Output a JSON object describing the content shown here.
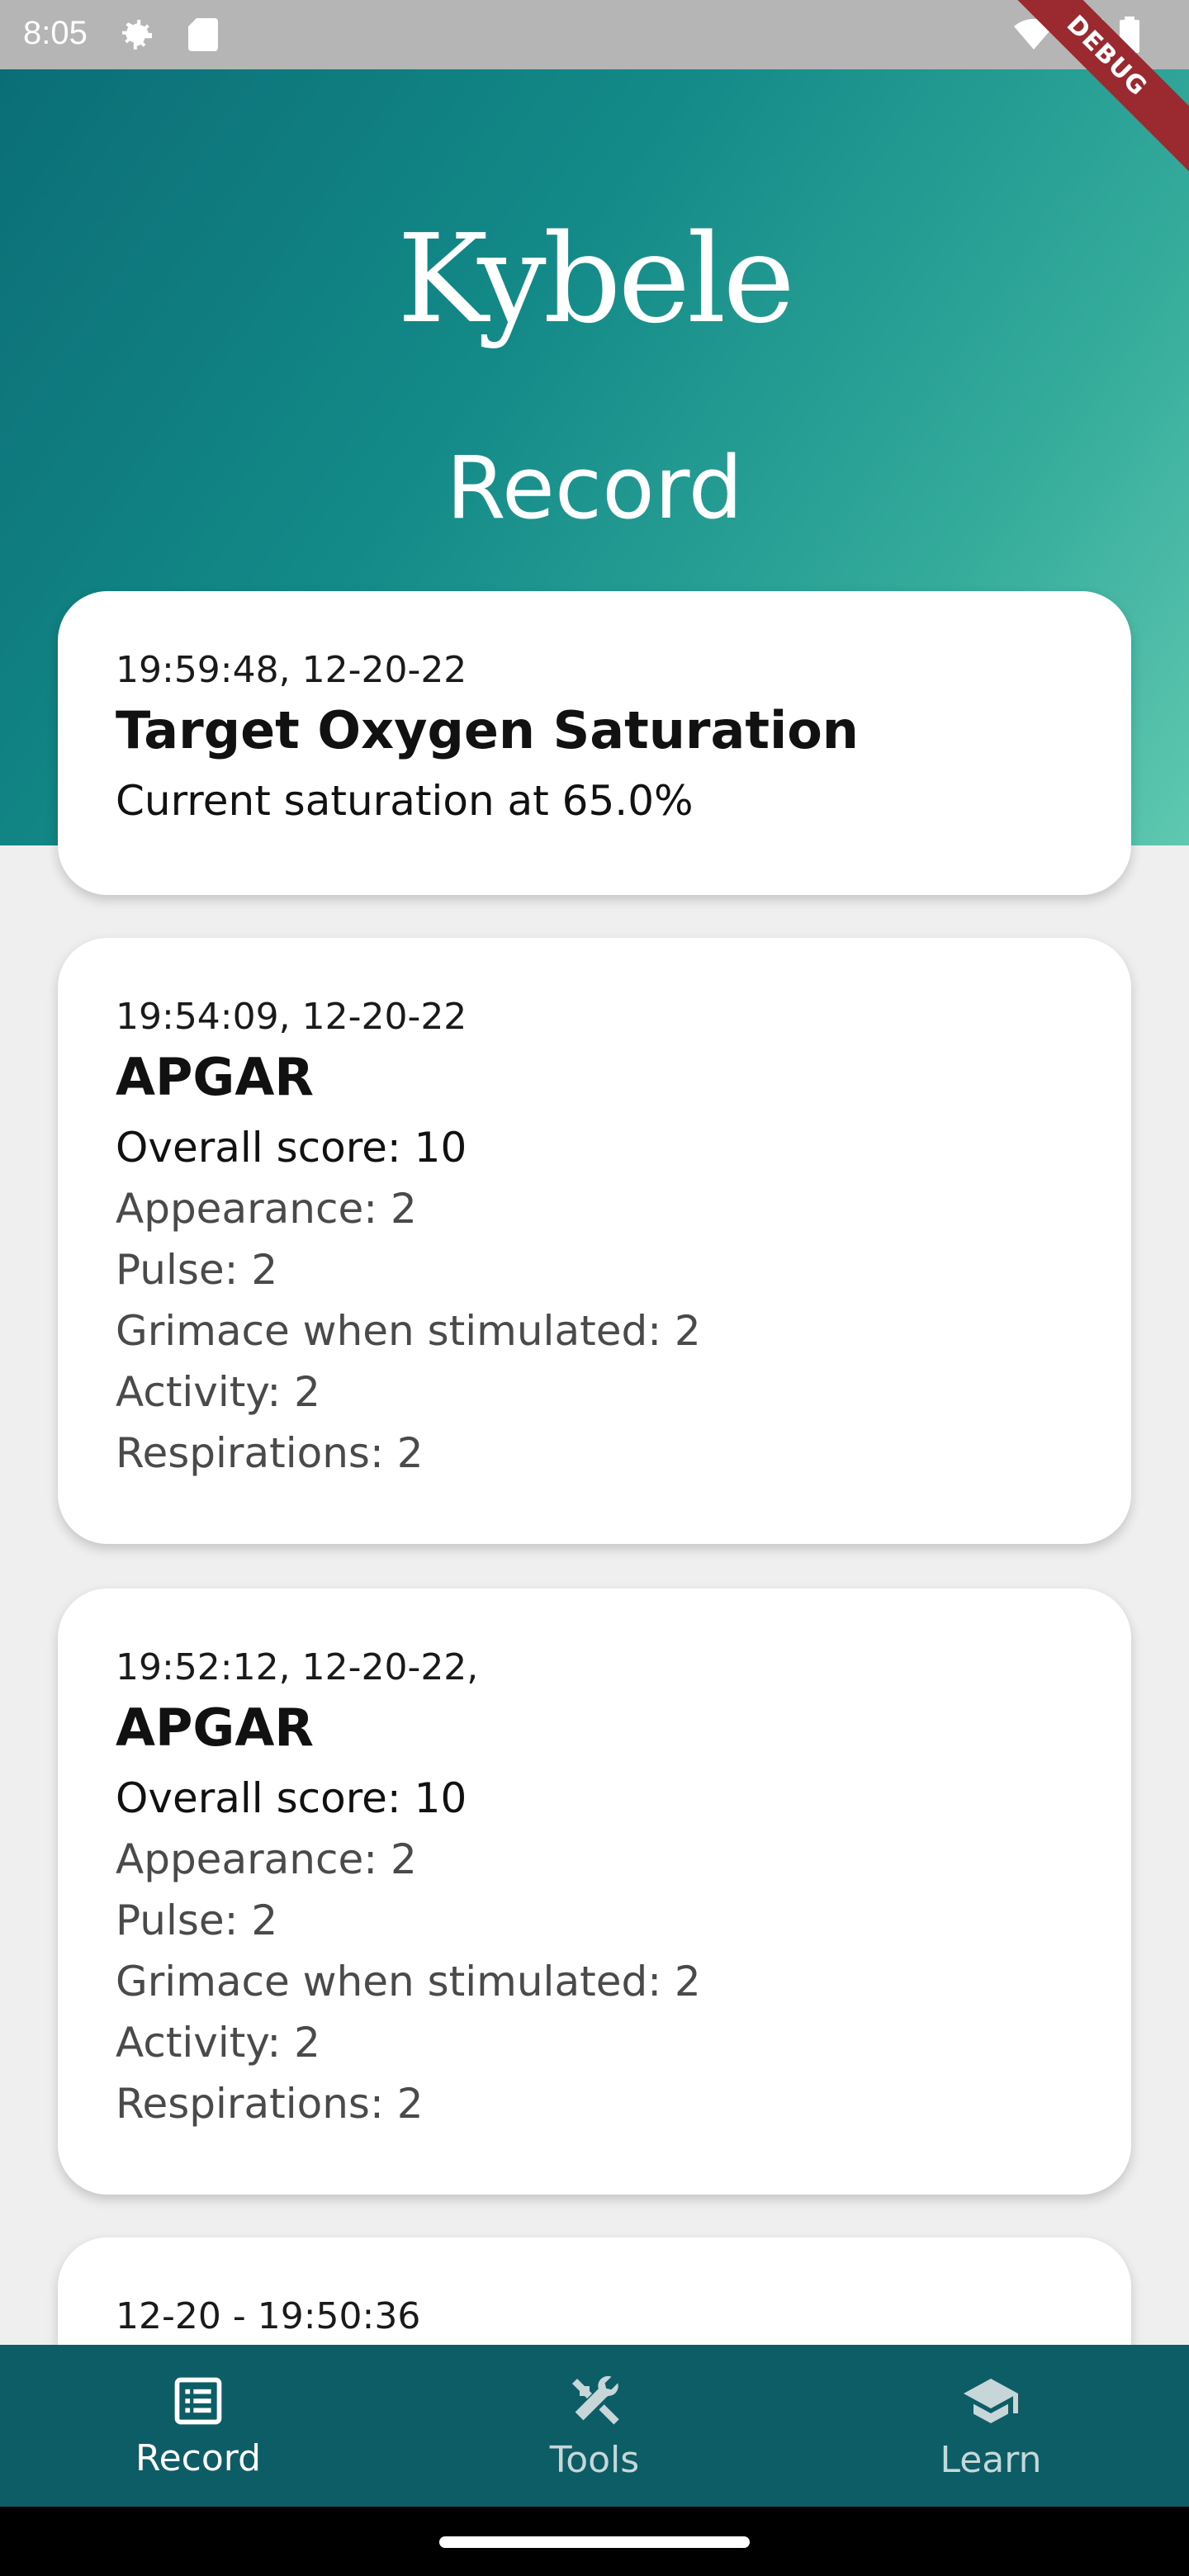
{
  "status_bar": {
    "time": "8:05",
    "debug_label": "DEBUG"
  },
  "header": {
    "logo": "Kybele",
    "title": "Record"
  },
  "records": [
    {
      "time": "19:59:48, 12-20-22",
      "title": "Target Oxygen Saturation",
      "lines": [
        "Current saturation at 65.0%"
      ]
    },
    {
      "time": "19:54:09, 12-20-22",
      "title": "APGAR",
      "overall": "Overall score: 10",
      "lines": [
        "Appearance: 2",
        "Pulse: 2",
        "Grimace when stimulated: 2",
        "Activity: 2",
        "Respirations: 2"
      ]
    },
    {
      "time": "19:52:12, 12-20-22,",
      "title": "APGAR",
      "overall": "Overall score: 10",
      "lines": [
        "Appearance: 2",
        "Pulse: 2",
        "Grimace when stimulated: 2",
        "Activity: 2",
        "Respirations: 2"
      ]
    },
    {
      "time": "12-20 - 19:50:36"
    }
  ],
  "nav": {
    "items": [
      {
        "label": "Record",
        "icon": "list-icon",
        "active": true
      },
      {
        "label": "Tools",
        "icon": "tools-icon",
        "active": false
      },
      {
        "label": "Learn",
        "icon": "school-icon",
        "active": false
      }
    ]
  },
  "colors": {
    "nav_bg": "#0d5d66",
    "header_start": "#0b6e77",
    "header_end": "#5fc8b0"
  }
}
